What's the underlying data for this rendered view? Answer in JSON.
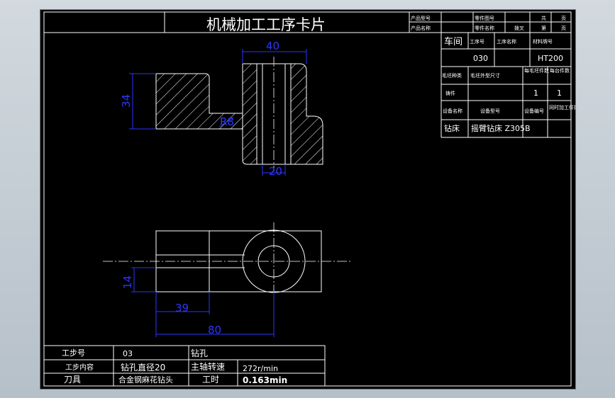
{
  "title": "机械加工工序卡片",
  "header": {
    "product_model": "产品型号",
    "product_name": "产品名称",
    "part_drawing_no": "零件图号",
    "part_name": "零件名称",
    "part_name_value": "拨叉",
    "total_label": "共",
    "page_label": "页",
    "sheet_label": "第",
    "page_label2": "页"
  },
  "right_table": {
    "workshop": "车间",
    "process_no": "工序号",
    "process_name": "工序名称",
    "material_grade": "材料牌号",
    "process_no_value": "030",
    "material_value": "HT200",
    "blank_type": "毛坯种类",
    "blank_size": "毛坯外型尺寸",
    "blanks_per": "每毛坯件数",
    "parts_per": "每台件数",
    "blank_type_value": "铸件",
    "blanks_per_value": "1",
    "parts_per_value": "1",
    "equip_name": "设备名称",
    "equip_model": "设备型号",
    "equip_no": "设备编号",
    "simul_parts": "同时加工件数",
    "equip_name_value": "钻床",
    "equip_model_value": "摇臂钻床 Z305B"
  },
  "dimensions": {
    "top_width": "40",
    "height": "34",
    "hole": "R8",
    "bottom": "20",
    "slot": "14",
    "len1": "39",
    "len2": "80"
  },
  "bottom_table": {
    "step_no_label": "工步号",
    "step_no_value": "03",
    "step_content_label": "工步内容",
    "step_content_value": "钻孔直径20",
    "tool_label": "刀具",
    "tool_value": "合金钢麻花钻头",
    "op_label": "钻孔",
    "spindle_label": "主轴转速",
    "spindle_value": "272r/min",
    "time_label": "工时",
    "time_value": "0.163min"
  }
}
